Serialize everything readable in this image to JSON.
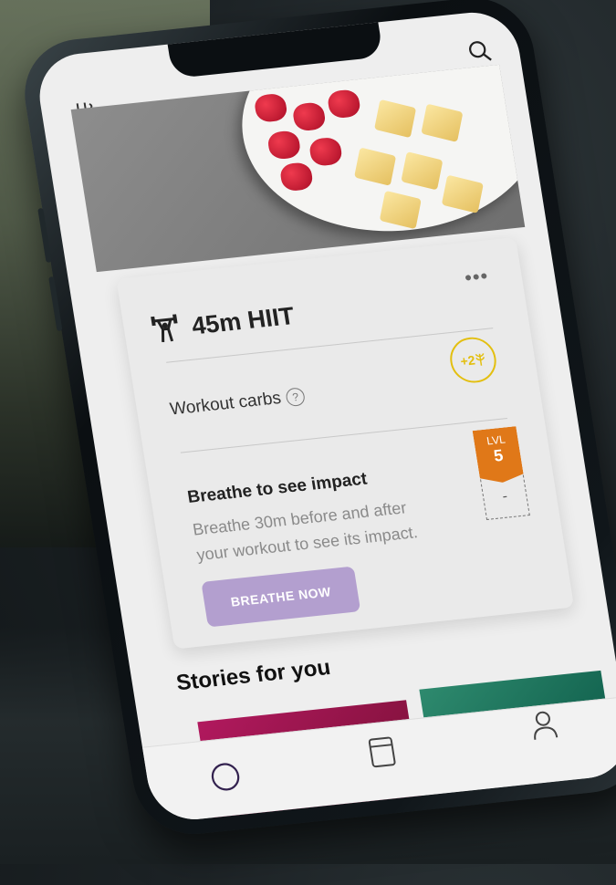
{
  "header": {
    "logo_icon": "breath-wave-icon",
    "search_icon": "search-icon"
  },
  "workout_card": {
    "title": "45m HIIT",
    "title_icon": "weightlifter-icon",
    "more_label": "•••",
    "carbs": {
      "label": "Workout carbs",
      "help_label": "?",
      "badge_value": "+2",
      "badge_color": "#e3bf10"
    },
    "breathe": {
      "title": "Breathe to see impact",
      "description": "Breathe 30m before and after your workout to see its impact.",
      "button_label": "BREATHE NOW",
      "button_color": "#b39fcf"
    },
    "level": {
      "label": "LVL",
      "value": "5",
      "next_value": "-",
      "color": "#e07818"
    }
  },
  "stories": {
    "title": "Stories for you"
  },
  "tabbar": {
    "items": [
      "home-circle-icon",
      "book-icon",
      "profile-icon"
    ]
  }
}
